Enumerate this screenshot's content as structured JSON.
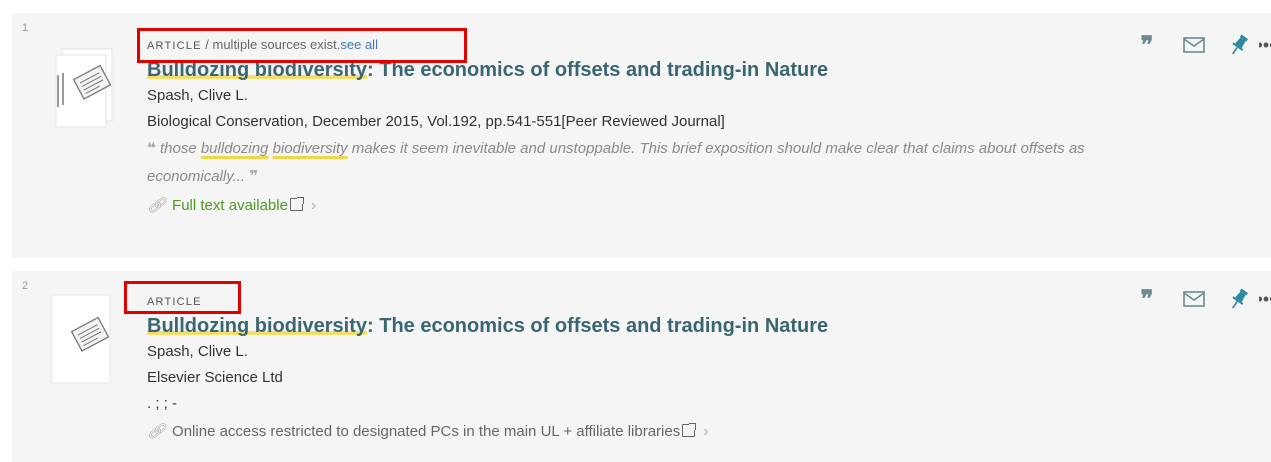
{
  "results": [
    {
      "number": "1",
      "type": "ARTICLE",
      "sources_text": " / multiple sources exist.",
      "see_all": "see all",
      "title_hl": "Bulldozing biodiversity",
      "title_rest": ": The economics of offsets and trading-in Nature",
      "author": "Spash, Clive L.",
      "publication": "Biological Conservation, December 2015, Vol.192, pp.541-551[Peer Reviewed Journal]",
      "snippet_open": "❝",
      "snippet_pre": " those ",
      "snippet_hl1": "bulldozing",
      "snippet_sp": " ",
      "snippet_hl2": "biodiversity",
      "snippet_post": " makes it seem inevitable and unstoppable. This brief exposition should make clear that claims about offsets as economically...",
      "snippet_close": "❞",
      "availability": "Full text available",
      "availability_color": "#4a9a24"
    },
    {
      "number": "2",
      "type": "ARTICLE",
      "title_hl": "Bulldozing biodiversity",
      "title_rest": ": The economics of offsets and trading-in Nature",
      "author": "Spash, Clive L.",
      "publisher": "Elsevier Science Ltd",
      "extra": ". ; ; -",
      "availability": "Online access restricted to designated PCs in the main UL + affiliate libraries",
      "availability_color": "#666666"
    }
  ],
  "actions": {
    "cite_glyph": "❞",
    "more_glyph": "•••",
    "icons": [
      "quote-icon",
      "mail-icon",
      "pin-icon",
      "more-icon"
    ]
  },
  "colors": {
    "title": "#3a6672",
    "highlight": "#f5dd6a",
    "annotation": "#e00000",
    "link": "#3d78b4"
  }
}
